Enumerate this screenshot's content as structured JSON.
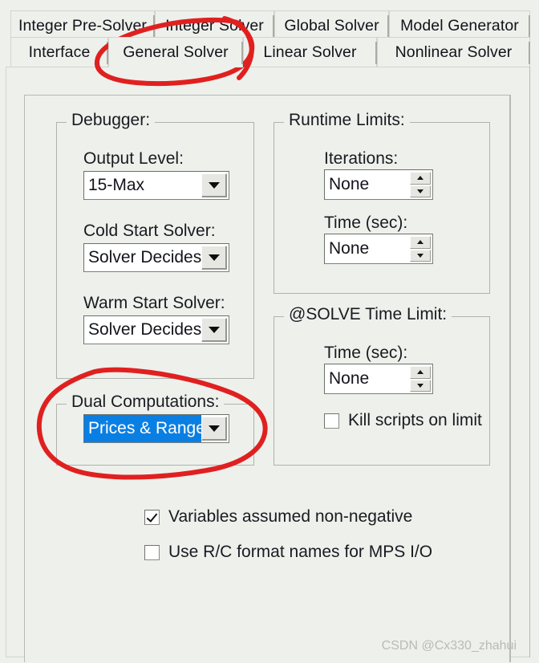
{
  "window": {
    "accent_selection": "#0a7fe3",
    "ink_color": "#e02020",
    "background": "#eef0eb"
  },
  "tabs": {
    "row1": [
      {
        "label": "Integer Pre-Solver",
        "selected": false
      },
      {
        "label": "Integer Solver",
        "selected": false
      },
      {
        "label": "Global Solver",
        "selected": false
      },
      {
        "label": "Model Generator",
        "selected": false
      }
    ],
    "row2": [
      {
        "label": "Interface",
        "selected": false
      },
      {
        "label": "General Solver",
        "selected": true
      },
      {
        "label": "Linear Solver",
        "selected": false
      },
      {
        "label": "Nonlinear Solver",
        "selected": false
      }
    ]
  },
  "groups": {
    "debugger": {
      "legend": "Debugger:",
      "fields": [
        {
          "label": "Output Level:",
          "value": "15-Max"
        },
        {
          "label": "Cold Start Solver:",
          "value": "Solver Decides"
        },
        {
          "label": "Warm Start Solver:",
          "value": "Solver Decides"
        }
      ]
    },
    "dual_computations": {
      "legend": "Dual Computations:",
      "value": "Prices & Ranges",
      "highlighted": true
    },
    "runtime_limits": {
      "legend": "Runtime Limits:",
      "fields": [
        {
          "label": "Iterations:",
          "value": "None"
        },
        {
          "label": "Time (sec):",
          "value": "None"
        }
      ]
    },
    "solve_time_limit": {
      "legend": "@SOLVE Time Limit:",
      "field": {
        "label": "Time (sec):",
        "value": "None"
      },
      "checkbox": {
        "label": "Kill scripts on limit",
        "checked": false
      }
    }
  },
  "options": [
    {
      "label": "Variables assumed non-negative",
      "checked": true
    },
    {
      "label": "Use R/C format names for MPS I/O",
      "checked": false
    }
  ],
  "watermark": "CSDN @Cx330_zhahui",
  "icons": {
    "combo_arrow": "chevron-down-icon",
    "spin_up": "spinner-up-icon",
    "spin_down": "spinner-down-icon",
    "check": "checkmark-icon"
  }
}
